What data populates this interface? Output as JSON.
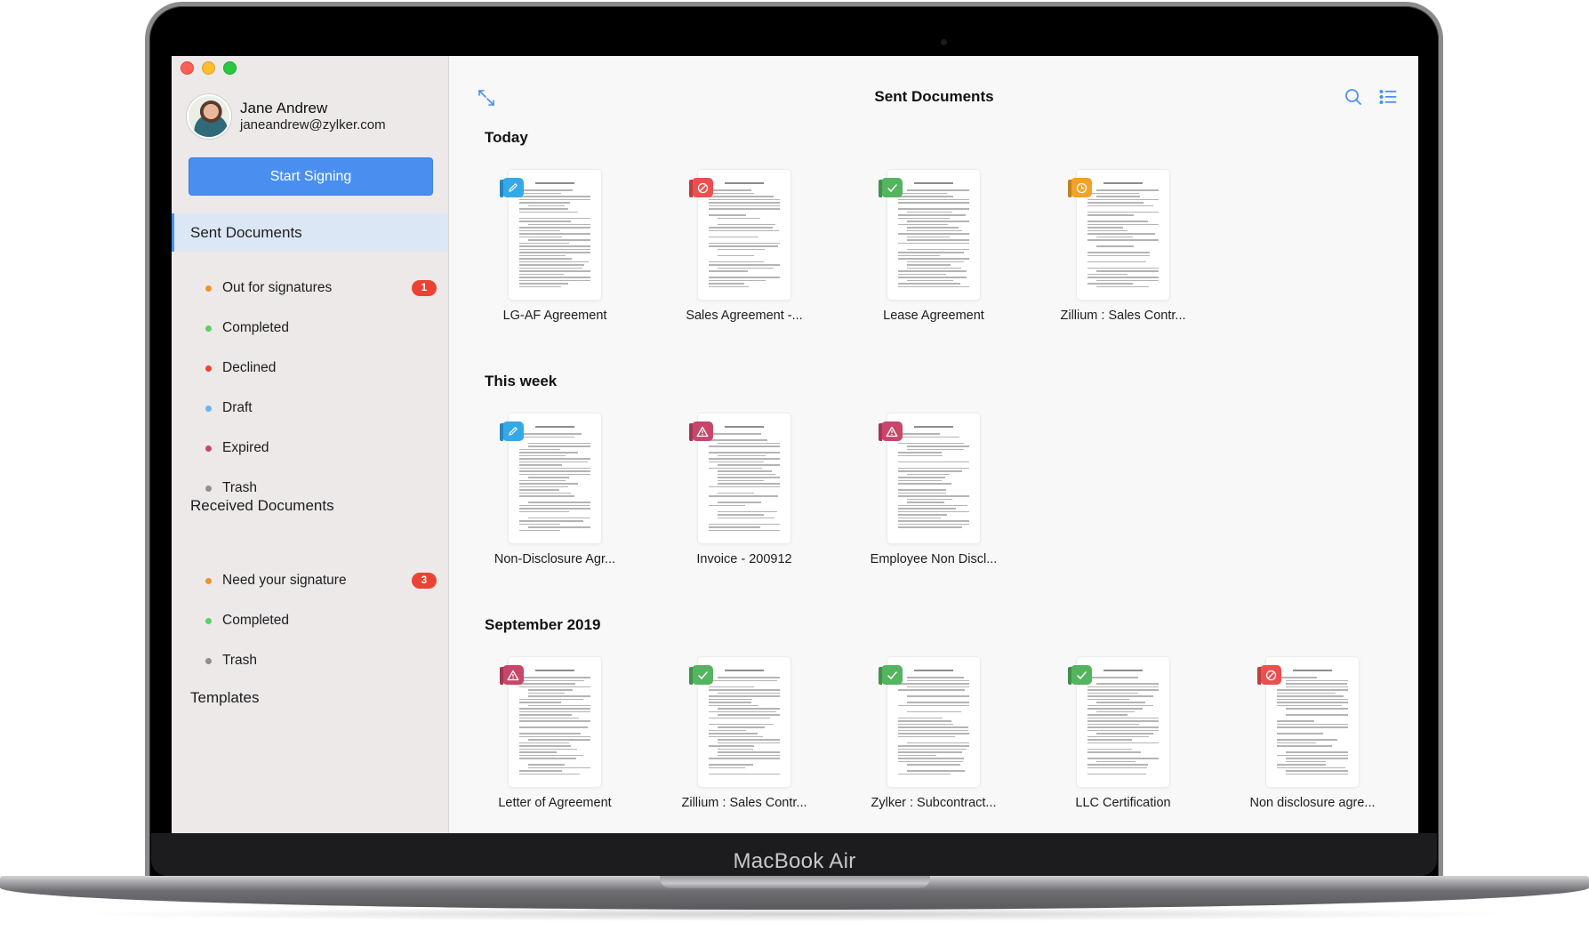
{
  "device": {
    "label": "MacBook Air"
  },
  "window_controls": [
    "close",
    "minimize",
    "zoom"
  ],
  "profile": {
    "name": "Jane Andrew",
    "email": "janeandrew@zylker.com"
  },
  "sidebar": {
    "start_button": "Start Signing",
    "sent_header": "Sent Documents",
    "sent_items": [
      {
        "label": "Out for signatures",
        "dot_color": "#f0912e",
        "badge": "1"
      },
      {
        "label": "Completed",
        "dot_color": "#5bcf63",
        "badge": null
      },
      {
        "label": "Declined",
        "dot_color": "#ea4335",
        "badge": null
      },
      {
        "label": "Draft",
        "dot_color": "#6cb4f6",
        "badge": null
      },
      {
        "label": "Expired",
        "dot_color": "#c8466a",
        "badge": null
      },
      {
        "label": "Trash",
        "dot_color": "#8e8e93",
        "badge": null
      }
    ],
    "received_header": "Received Documents",
    "received_items": [
      {
        "label": "Need your signature",
        "dot_color": "#f0912e",
        "badge": "3"
      },
      {
        "label": "Completed",
        "dot_color": "#5bcf63",
        "badge": null
      },
      {
        "label": "Trash",
        "dot_color": "#8e8e93",
        "badge": null
      }
    ],
    "templates_header": "Templates"
  },
  "main": {
    "title": "Sent Documents",
    "accent_color": "#4a8ff0",
    "sections": [
      {
        "title": "Today",
        "documents": [
          {
            "name": "LG-AF Agreement",
            "status": "draft",
            "status_color": "#34a9e8",
            "status_icon": "pencil"
          },
          {
            "name": "Sales Agreement -...",
            "status": "declined",
            "status_color": "#ec4f4f",
            "status_icon": "prohibited"
          },
          {
            "name": "Lease Agreement",
            "status": "completed",
            "status_color": "#54b45f",
            "status_icon": "check"
          },
          {
            "name": "Zillium : Sales Contr...",
            "status": "out-for-signature",
            "status_color": "#f0a22b",
            "status_icon": "clock"
          }
        ]
      },
      {
        "title": "This week",
        "documents": [
          {
            "name": "Non-Disclosure Agr...",
            "status": "draft",
            "status_color": "#34a9e8",
            "status_icon": "pencil"
          },
          {
            "name": "Invoice - 200912",
            "status": "expired",
            "status_color": "#c8466a",
            "status_icon": "warning"
          },
          {
            "name": "Employee Non Discl...",
            "status": "expired",
            "status_color": "#c8466a",
            "status_icon": "warning"
          }
        ]
      },
      {
        "title": "September 2019",
        "documents": [
          {
            "name": "Letter of Agreement",
            "status": "expired",
            "status_color": "#c8466a",
            "status_icon": "warning"
          },
          {
            "name": "Zillium : Sales Contr...",
            "status": "completed",
            "status_color": "#54b45f",
            "status_icon": "check"
          },
          {
            "name": "Zylker : Subcontract...",
            "status": "completed",
            "status_color": "#54b45f",
            "status_icon": "check"
          },
          {
            "name": "LLC Certification",
            "status": "completed",
            "status_color": "#54b45f",
            "status_icon": "check"
          },
          {
            "name": "Non disclosure agre...",
            "status": "declined",
            "status_color": "#ec4f4f",
            "status_icon": "prohibited"
          }
        ]
      }
    ]
  }
}
